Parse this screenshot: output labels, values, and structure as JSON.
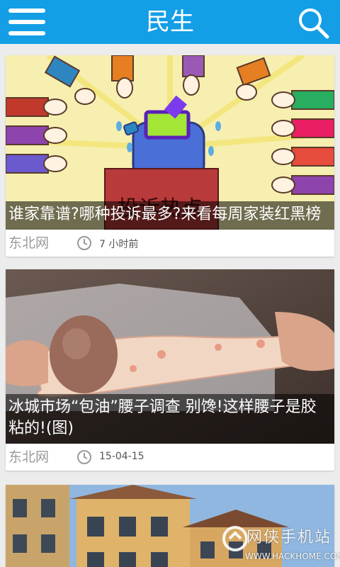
{
  "header": {
    "title": "民生",
    "menu_icon": "hamburger-menu-icon",
    "search_icon": "search-icon",
    "brand_color": "#139ee6"
  },
  "feed": {
    "items": [
      {
        "headline": "谁家靠谱?哪种投诉最多?来看每周家装红黑榜",
        "source": "东北网",
        "time": "7 小时前",
        "image_sign_text": "投诉热点"
      },
      {
        "headline": "冰城市场“包油”腰子调查 别馋!这样腰子是胶粘的!(图)",
        "source": "东北网",
        "time": "15-04-15"
      },
      {
        "headline": "",
        "source": "",
        "time": ""
      }
    ]
  },
  "watermark": {
    "text": "网侠手机站",
    "url": "WWW.HACKHOME.COM"
  }
}
